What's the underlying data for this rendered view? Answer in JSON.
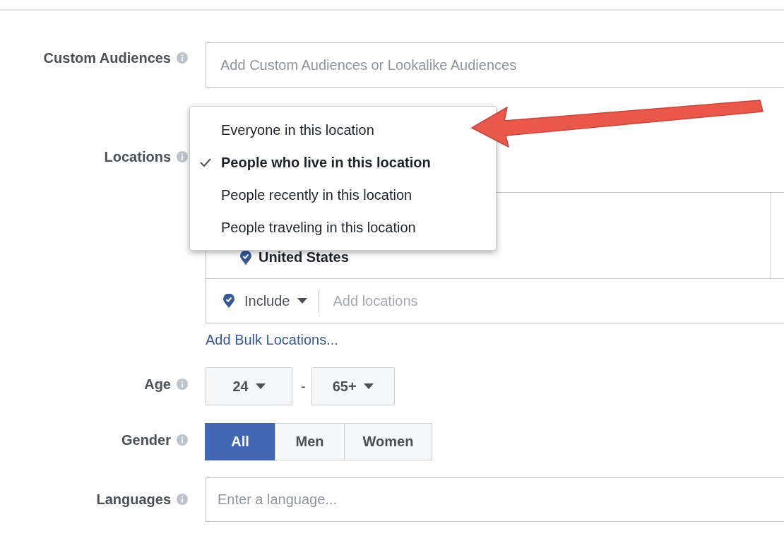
{
  "custom_audiences": {
    "label": "Custom Audiences",
    "placeholder": "Add Custom Audiences or Lookalike Audiences"
  },
  "locations": {
    "label": "Locations",
    "menu": [
      {
        "label": "Everyone in this location",
        "selected": false
      },
      {
        "label": "People who live in this location",
        "selected": true
      },
      {
        "label": "People recently in this location",
        "selected": false
      },
      {
        "label": "People traveling in this location",
        "selected": false
      }
    ],
    "selected_locations": [
      "United States"
    ],
    "include_dropdown": "Include",
    "placeholder": "Add locations",
    "bulk_link": "Add Bulk Locations..."
  },
  "age": {
    "label": "Age",
    "from": "24",
    "separator": "-",
    "to": "65+"
  },
  "gender": {
    "label": "Gender",
    "options": [
      {
        "label": "All",
        "selected": true
      },
      {
        "label": "Men",
        "selected": false
      },
      {
        "label": "Women",
        "selected": false
      }
    ]
  },
  "languages": {
    "label": "Languages",
    "placeholder": "Enter a language..."
  }
}
